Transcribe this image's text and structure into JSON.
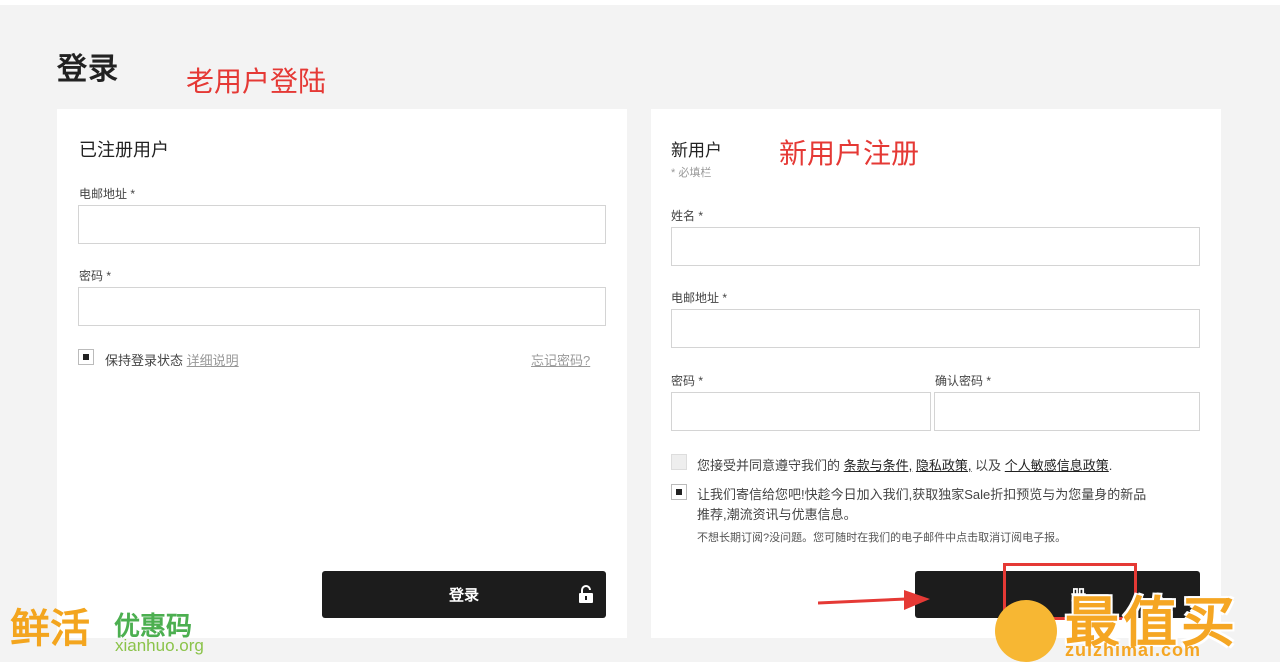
{
  "page": {
    "title": "登录"
  },
  "annotations": {
    "old_user": "老用户登陆",
    "new_user": "新用户注册"
  },
  "login": {
    "heading": "已注册用户",
    "email_label": "电邮地址 *",
    "password_label": "密码 *",
    "remember_label": "保持登录状态",
    "remember_checked": true,
    "details_link": "详细说明",
    "forgot_link": "忘记密码?",
    "submit_label": "登录"
  },
  "register": {
    "heading": "新用户",
    "required_note": "* 必填栏",
    "name_label": "姓名 *",
    "email_label": "电邮地址 *",
    "password_label": "密码 *",
    "confirm_label": "确认密码 *",
    "terms_prefix": "您接受并同意遵守我们的",
    "terms_link": "条款与条件,",
    "privacy_link": "隐私政策,",
    "terms_and": "以及",
    "sensitive_link": "个人敏感信息政策",
    "terms_suffix": ".",
    "terms_checked": false,
    "newsletter_line1": "让我们寄信给您吧!快趁今日加入我们,获取独家Sale折扣预览与为您量身的新品",
    "newsletter_line2": "推荐,潮流资讯与优惠信息。",
    "newsletter_note": "不想长期订阅?没问题。您可随时在我们的电子邮件中点击取消订阅电子报。",
    "newsletter_checked": true,
    "submit_label": "册"
  },
  "watermarks": {
    "left_big": "鲜活",
    "left_mid": "优惠码",
    "left_url": "xianhuo.org",
    "right_big": "最值买",
    "right_url": "zuizhimai.com"
  },
  "colors": {
    "annotation_red": "#e53935",
    "button_dark": "#1c1c1c",
    "background": "#f3f3f3"
  },
  "icons": {
    "lock": "lock-icon",
    "arrow": "arrow-right-icon"
  }
}
